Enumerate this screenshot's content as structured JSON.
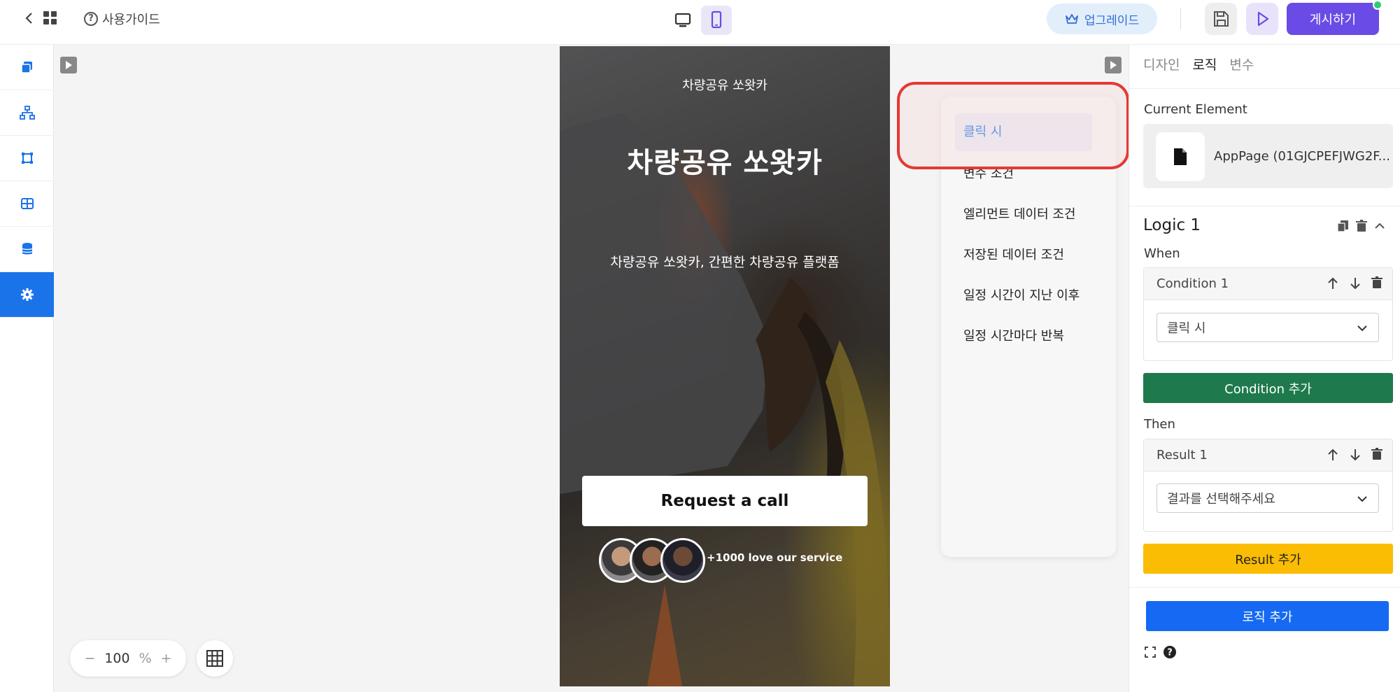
{
  "topbar": {
    "guide_label": "사용가이드",
    "upgrade_label": "업그레이드",
    "publish_label": "게시하기"
  },
  "canvas": {
    "zoom_value": "100",
    "zoom_unit": "%"
  },
  "phone": {
    "small_title": "차량공유 쏘왓카",
    "big_title": "차량공유 쏘왓카",
    "subtitle": "차량공유 쏘왓카, 간편한 차량공유 플랫폼",
    "cta_label": "Request a call",
    "social_proof": "+1000 love our service"
  },
  "popup": {
    "items": [
      "클릭 시",
      "변수 조건",
      "엘리먼트 데이터 조건",
      "저장된 데이터 조건",
      "일정 시간이 지난 이후",
      "일정 시간마다 반복"
    ]
  },
  "panel": {
    "tabs": [
      "디자인",
      "로직",
      "변수"
    ],
    "active_tab": "로직",
    "current_element_label": "Current Element",
    "current_element_value": "AppPage (01GJCPEFJWG2F...",
    "logic_title": "Logic 1",
    "when_label": "When",
    "condition_title": "Condition 1",
    "condition_select": "클릭 시",
    "add_condition_label": "Condition 추가",
    "then_label": "Then",
    "result_title": "Result 1",
    "result_select": "결과를 선택해주세요",
    "add_result_label": "Result 추가",
    "add_logic_label": "로직 추가"
  },
  "colors": {
    "accent_blue": "#1a73e8",
    "publish_purple": "#6a4be6",
    "condition_green": "#1e7a4c",
    "result_yellow": "#fbbc04",
    "highlight_red": "#e53935"
  }
}
